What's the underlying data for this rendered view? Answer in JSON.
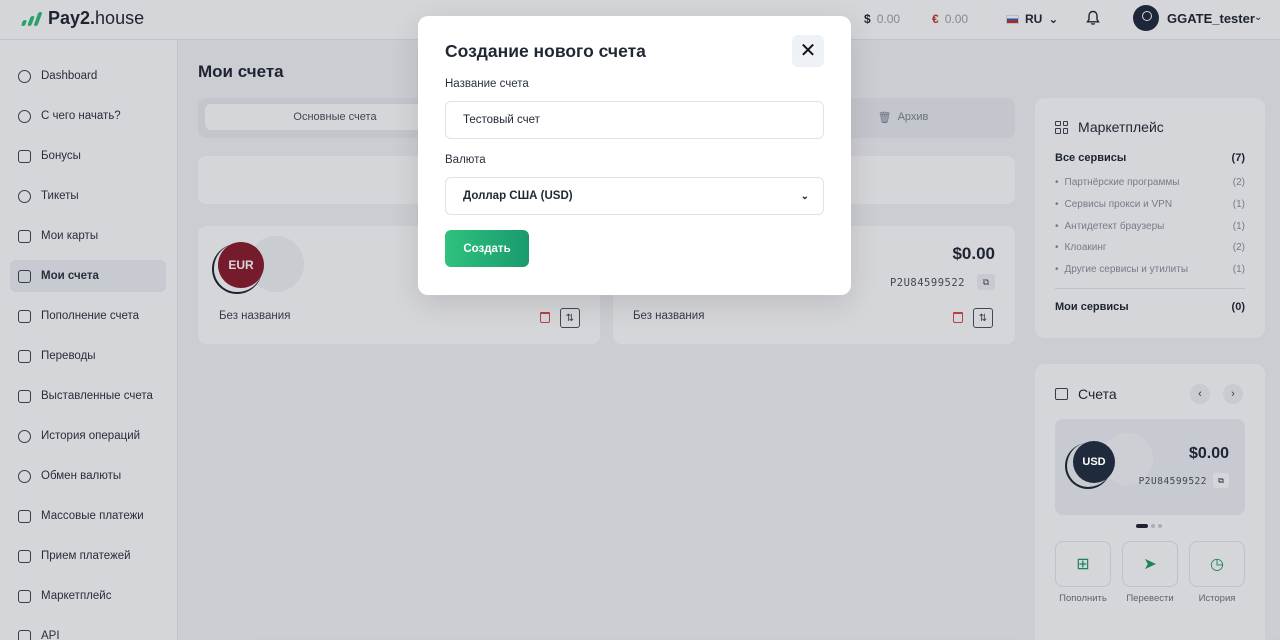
{
  "header": {
    "logo_bold": "Pay2.",
    "logo_light": "house",
    "balance_usd_symbol": "$",
    "balance_usd": "0.00",
    "balance_eur_symbol": "€",
    "balance_eur": "0.00",
    "language": "RU",
    "username": "GGATE_tester"
  },
  "sidebar": {
    "items": [
      {
        "label": "Dashboard"
      },
      {
        "label": "С чего начать?"
      },
      {
        "label": "Бонусы"
      },
      {
        "label": "Тикеты"
      },
      {
        "label": "Мои карты"
      },
      {
        "label": "Мои счета",
        "active": true
      },
      {
        "label": "Пополнение счета"
      },
      {
        "label": "Переводы"
      },
      {
        "label": "Выставленные счета"
      },
      {
        "label": "История операций"
      },
      {
        "label": "Обмен валюты"
      },
      {
        "label": "Массовые платежи"
      },
      {
        "label": "Прием платежей"
      },
      {
        "label": "Маркетплейс"
      },
      {
        "label": "API"
      }
    ]
  },
  "main": {
    "title": "Мои счета",
    "tabs": [
      {
        "label": "Основные счета",
        "active": true
      },
      {
        "label": "Архив"
      }
    ],
    "accounts": [
      {
        "currency": "EUR",
        "name": "Без названия"
      },
      {
        "amount": "$0.00",
        "number": "P2U84599522",
        "name": "Без названия"
      }
    ]
  },
  "marketplace": {
    "title": "Маркетплейс",
    "all_label": "Все сервисы",
    "all_count": "(7)",
    "items": [
      {
        "label": "Партнёрские программы",
        "count": "(2)"
      },
      {
        "label": "Сервисы прокси и VPN",
        "count": "(1)"
      },
      {
        "label": "Антидетект браузеры",
        "count": "(1)"
      },
      {
        "label": "Клоакинг",
        "count": "(2)"
      },
      {
        "label": "Другие сервисы и утилиты",
        "count": "(1)"
      }
    ],
    "my_label": "Мои сервисы",
    "my_count": "(0)"
  },
  "accounts_panel": {
    "title": "Счета",
    "currency": "USD",
    "amount": "$0.00",
    "number": "P2U84599522",
    "actions": [
      {
        "label": "Пополнить"
      },
      {
        "label": "Перевести"
      },
      {
        "label": "История"
      }
    ]
  },
  "modal": {
    "title": "Создание нового счета",
    "name_label": "Название счета",
    "name_value": "Тестовый счет",
    "currency_label": "Валюта",
    "currency_value": "Доллар США (USD)",
    "submit_label": "Создать"
  }
}
